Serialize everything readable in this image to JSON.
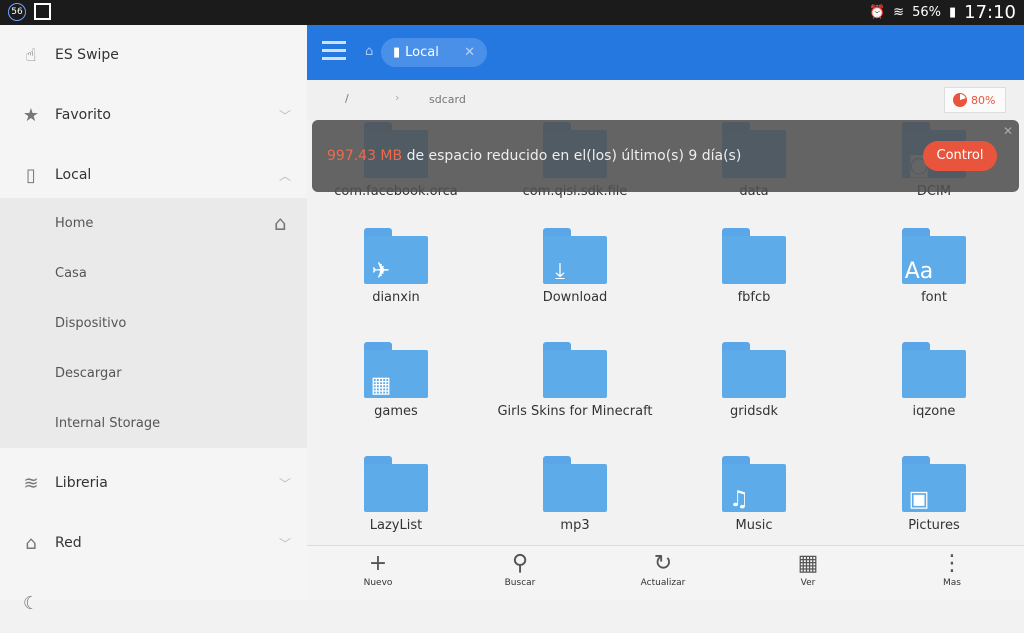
{
  "status": {
    "notif_badge": "56",
    "battery": "56%",
    "time": "17:10"
  },
  "sidebar": {
    "items": [
      {
        "label": "ES Swipe",
        "icon": "hand-swipe-icon"
      },
      {
        "label": "Favorito",
        "icon": "star-icon"
      },
      {
        "label": "Local",
        "icon": "phone-icon"
      },
      {
        "label": "Libreria",
        "icon": "layers-icon"
      },
      {
        "label": "Red",
        "icon": "router-icon"
      }
    ],
    "sub_items": [
      "Home",
      "Casa",
      "Dispositivo",
      "Descargar",
      "Internal Storage"
    ]
  },
  "header": {
    "tab_label": "Local"
  },
  "breadcrumb": {
    "root": "/",
    "current": "sdcard",
    "storage_pct": "80%",
    "storage_used_fraction": 0.8
  },
  "banner": {
    "amount": "997.43 MB",
    "text": " de espacio reducido en el(los) último(s) 9 día(s)",
    "button": "Control"
  },
  "folders": [
    "com.facebook.orca",
    "com.qisi.sdk.file",
    "data",
    "DCIM",
    "dianxin",
    "Download",
    "fbfcb",
    "font",
    "games",
    "Girls Skins for Minecraft",
    "gridsdk",
    "iqzone",
    "LazyList",
    "mp3",
    "Music",
    "Pictures"
  ],
  "toolbar": {
    "new": "Nuevo",
    "search": "Buscar",
    "refresh": "Actualizar",
    "view": "Ver",
    "more": "Mas"
  },
  "colors": {
    "accent": "#2478e0",
    "folder": "#5dace9",
    "highlight": "#e8553c"
  }
}
